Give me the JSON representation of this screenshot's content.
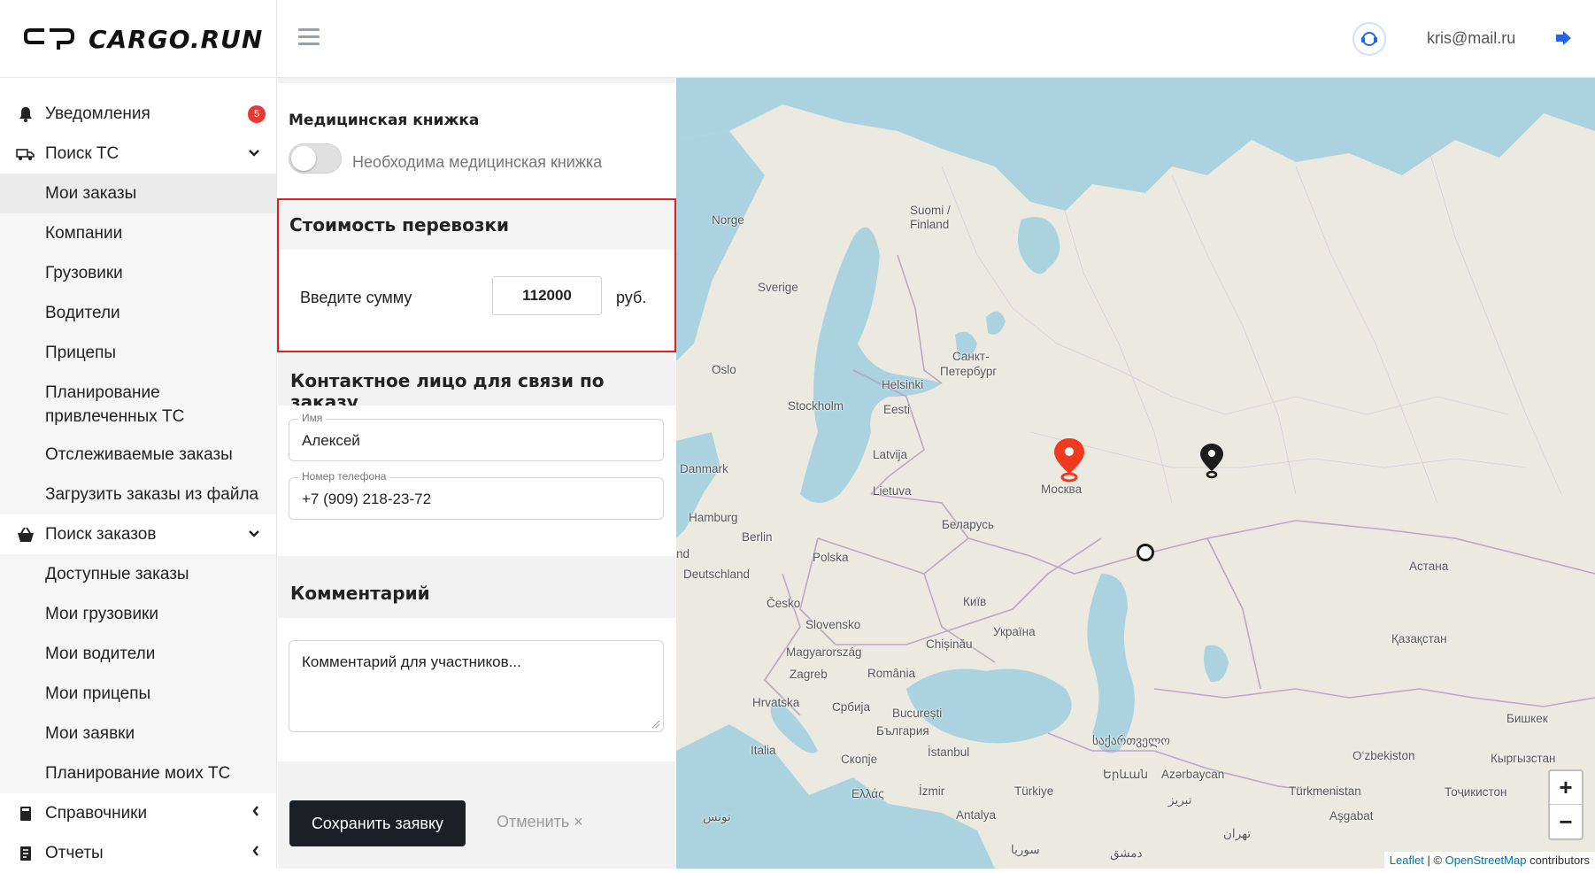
{
  "header": {
    "brand": "CARGO.RUN",
    "user_email": "kris@mail.ru"
  },
  "sidebar": {
    "items": [
      {
        "label": "Уведомления",
        "icon": "bell-icon",
        "badge": "5"
      },
      {
        "label": "Поиск ТС",
        "icon": "truck-icon",
        "expanded": true
      },
      {
        "label": "Мои заказы",
        "active": true
      },
      {
        "label": "Компании"
      },
      {
        "label": "Грузовики"
      },
      {
        "label": "Водители"
      },
      {
        "label": "Прицепы"
      },
      {
        "label": "Планирование привлеченных ТС"
      },
      {
        "label": "Отслеживаемые заказы"
      },
      {
        "label": "Загрузить заказы из файла"
      },
      {
        "label": "Поиск заказов",
        "icon": "basket-icon",
        "expanded": true
      },
      {
        "label": "Доступные заказы"
      },
      {
        "label": "Мои грузовики"
      },
      {
        "label": "Мои водители"
      },
      {
        "label": "Мои прицепы"
      },
      {
        "label": "Мои заявки"
      },
      {
        "label": "Планирование моих ТС"
      },
      {
        "label": "Справочники",
        "icon": "book-icon",
        "expanded": false
      },
      {
        "label": "Отчеты",
        "icon": "report-icon",
        "expanded": false
      }
    ],
    "plan_line1": "Планирование",
    "plan_line2": "привлеченных ТС"
  },
  "form": {
    "medbook": {
      "title": "Медицинская книжка",
      "toggle_label": "Необходима медицинская книжка",
      "toggle_on": false
    },
    "price": {
      "title": "Стоимость перевозки",
      "label": "Введите сумму",
      "value": "112000",
      "unit": "руб."
    },
    "contact": {
      "title": "Контактное лицо для связи по заказу",
      "name_label": "Имя",
      "name_value": "Алексей",
      "phone_label": "Номер телефона",
      "phone_value": "+7 (909) 218-23-72"
    },
    "comment": {
      "title": "Комментарий",
      "placeholder": "Комментарий для участников..."
    },
    "save_label": "Сохранить заявку",
    "cancel_label": "Отменить ×"
  },
  "map": {
    "cities": {
      "norge": "Norge",
      "suomi": "Suomi /",
      "finland": "Finland",
      "sverige": "Sverige",
      "oslo": "Oslo",
      "spb1": "Санкт-",
      "spb2": "Петербург",
      "helsinki": "Helsinki",
      "stockholm": "Stockholm",
      "eesti": "Eesti",
      "latvija": "Latvija",
      "danmark": "Danmark",
      "moskva": "Москва",
      "lietuva": "Lietuva",
      "hamburg": "Hamburg",
      "berlin": "Berlin",
      "belarus": "Беларусь",
      "nd": "nd",
      "polska": "Polska",
      "deutschland": "Deutschland",
      "astana": "Астана",
      "cesko": "Česko",
      "kyiv": "Київ",
      "slovensko": "Slovensko",
      "ukraina": "Україна",
      "kazakhstan": "Қазақстан",
      "magyar": "Magyarország",
      "chisinau": "Chișinău",
      "zagreb": "Zagreb",
      "romania": "România",
      "hrvatska": "Hrvatska",
      "srbija": "Србија",
      "bucuresti": "București",
      "bulgaria": "България",
      "bishkek": "Бишкек",
      "sakartvelo": "საქართველო",
      "italia": "Italia",
      "skopje": "Скопје",
      "istanbul": "İstanbul",
      "ozbekiston": "O‘zbekiston",
      "kyrgyzstan": "Кыргызстан",
      "yerevan": "Երևան",
      "azerbaycan": "Azərbaycan",
      "ellas": "Ελλάς",
      "izmir": "İzmir",
      "turkiye": "Türkiye",
      "turkmenistan": "Türkmenistan",
      "tojikiston": "Тоҷикистон",
      "tunis": "تونس",
      "antalya": "Antalya",
      "tabriz": "تبریز",
      "asgabat": "Aşgabat",
      "tehran": "تهران",
      "suriya": "سوريا",
      "dimashq": "دمشق",
      "zoom_in": "+",
      "zoom_out": "−"
    },
    "attribution": {
      "leaflet": "Leaflet",
      "sep": "| ©",
      "osm": "OpenStreetMap",
      "contrib": "contributors"
    },
    "colors": {
      "water": "#aad3df",
      "land": "#ece9e1",
      "marker_origin": "#f0391e",
      "marker_dest": "#1c1c1c",
      "border": "#b79fc4"
    }
  }
}
